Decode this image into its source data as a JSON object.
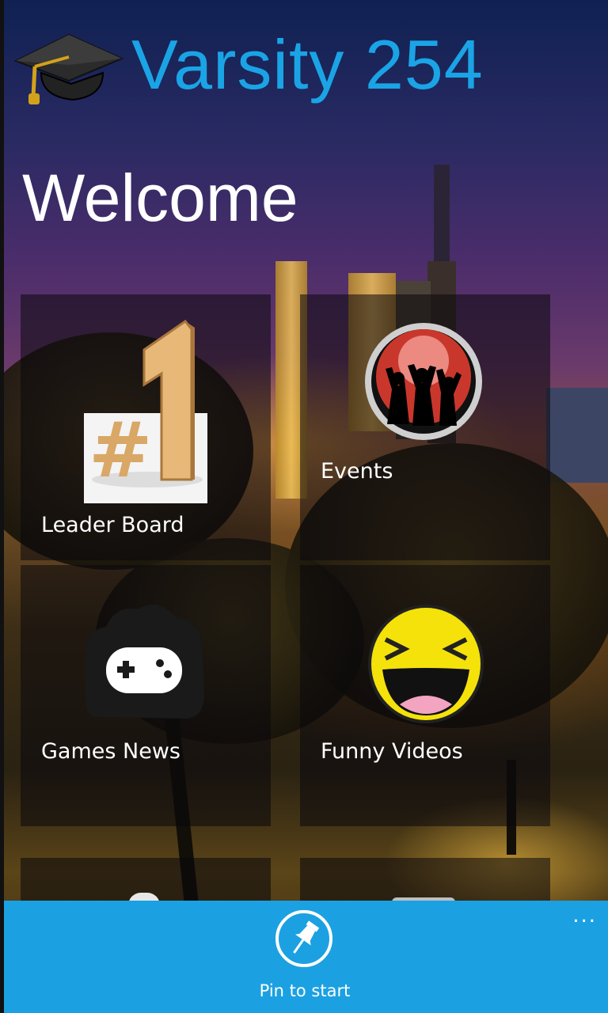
{
  "header": {
    "app_title": "Varsity 254",
    "page_title": "Welcome"
  },
  "tiles": [
    {
      "label": "Leader Board",
      "icon": "number-one-trophy-icon"
    },
    {
      "label": "Events",
      "icon": "party-crowd-icon"
    },
    {
      "label": "Games News",
      "icon": "gamepad-icon"
    },
    {
      "label": "Funny Videos",
      "icon": "laughing-face-icon"
    }
  ],
  "appbar": {
    "pin_label": "Pin to start",
    "more": "..."
  },
  "colors": {
    "accent": "#1ba1e2",
    "title": "#1aa4e6",
    "tile_bg": "rgba(10,8,12,0.55)"
  }
}
